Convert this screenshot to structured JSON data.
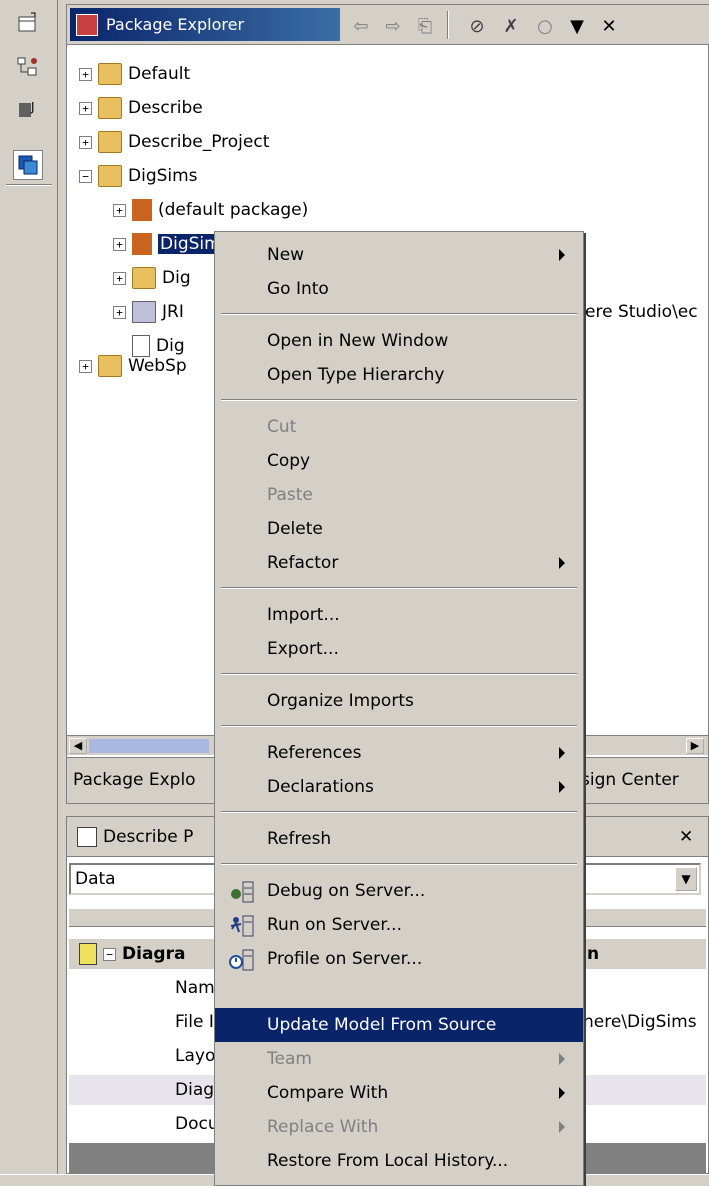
{
  "package_explorer": {
    "title": "Package Explorer",
    "tree": [
      {
        "label": "Default",
        "indent": 0,
        "expander": "+"
      },
      {
        "label": "Describe",
        "indent": 0,
        "expander": "+"
      },
      {
        "label": "Describe_Project",
        "indent": 0,
        "expander": "+"
      },
      {
        "label": "DigSims",
        "indent": 0,
        "expander": "-"
      },
      {
        "label": "(default package)",
        "indent": 1,
        "expander": "+"
      },
      {
        "label": "DigSim",
        "indent": 1,
        "expander": "+",
        "selected": true
      },
      {
        "label": "Dig",
        "indent": 1,
        "expander": "+"
      },
      {
        "label": "JRI",
        "indent": 1,
        "expander": "+"
      },
      {
        "label": "Dig",
        "indent": 1,
        "expander": ""
      },
      {
        "label": "WebSp",
        "indent": 0,
        "expander": "+"
      }
    ],
    "partial_right_text": "ere Studio\\ec",
    "bottom_tabs": {
      "left": "Package Explo",
      "right": "sign Center"
    }
  },
  "properties_view": {
    "title": "Describe P",
    "combo_value": "Data",
    "rows": {
      "header": "Diagra",
      "header_right": "n",
      "r1": "Nam",
      "r2": "File I",
      "r2_right": "nere\\DigSims",
      "r3": "Layo",
      "r4": "Diag",
      "r5": "Docu"
    }
  },
  "context_menu": {
    "new": "New",
    "go_into": "Go Into",
    "open_new_window": "Open in New Window",
    "open_type_hierarchy": "Open Type Hierarchy",
    "cut": "Cut",
    "copy": "Copy",
    "paste": "Paste",
    "delete": "Delete",
    "refactor": "Refactor",
    "import": "Import...",
    "export": "Export...",
    "organize_imports": "Organize Imports",
    "references": "References",
    "declarations": "Declarations",
    "refresh": "Refresh",
    "debug_on_server": "Debug on Server...",
    "run_on_server": "Run on Server...",
    "profile_on_server": "Profile on Server...",
    "update_model": "Update Model From Source",
    "team": "Team",
    "compare_with": "Compare With",
    "replace_with": "Replace With",
    "restore_history": "Restore From Local History..."
  },
  "colors": {
    "selection": "#0a246a",
    "title_gradient_start": "#0a246a",
    "title_gradient_end": "#3a6ea5",
    "chrome": "#d4d0c8"
  }
}
